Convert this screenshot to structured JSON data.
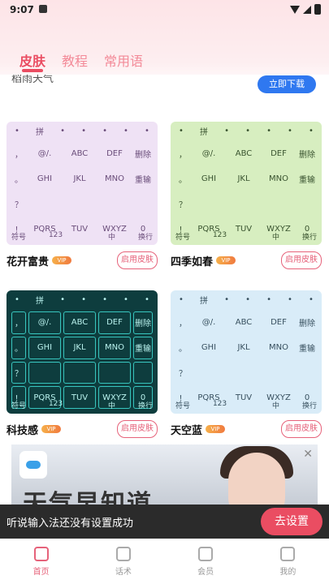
{
  "status_bar": {
    "time": "9:07"
  },
  "tabs": [
    {
      "label": "皮肤",
      "active": true
    },
    {
      "label": "教程",
      "active": false
    },
    {
      "label": "常用语",
      "active": false
    }
  ],
  "top_item": {
    "partial_name": "稻雨天气",
    "download_label": "立即下载"
  },
  "keyboard": {
    "pinyin_label": "拼",
    "rows": [
      [
        "，",
        "@/.",
        "ABC",
        "DEF",
        "删除"
      ],
      [
        "。",
        "GHI",
        "JKL",
        "MNO",
        "重输"
      ],
      [
        "？",
        "",
        "",
        "",
        ""
      ],
      [
        "！",
        "PQRS",
        "TUV",
        "WXYZ",
        "0"
      ]
    ],
    "bottom_row": [
      "符号",
      "123",
      "",
      "中",
      "换行"
    ]
  },
  "skins": [
    {
      "name": "花开富贵",
      "vip": "VIP",
      "button": "启用皮肤",
      "bg": "#efe2f5",
      "key_color": "#6a4d7a"
    },
    {
      "name": "四季如春",
      "vip": "VIP",
      "button": "启用皮肤",
      "bg": "#d7eec0",
      "key_color": "#39532f"
    },
    {
      "name": "科技感",
      "vip": "VIP",
      "button": "启用皮肤",
      "bg": "#0e3d3e",
      "key_color": "#b9f2ee"
    },
    {
      "name": "天空蓝",
      "vip": "VIP",
      "button": "启用皮肤",
      "bg": "#d9ecf8",
      "key_color": "#38505f"
    }
  ],
  "banner": {
    "headline": "天气早知道",
    "close": "✕"
  },
  "toast": {
    "message": "听说输入法还没有设置成功",
    "action": "去设置"
  },
  "nav": [
    {
      "label": "首页",
      "icon": "home-icon",
      "active": true
    },
    {
      "label": "话术",
      "icon": "chat-icon",
      "active": false
    },
    {
      "label": "会员",
      "icon": "crown-icon",
      "active": false
    },
    {
      "label": "我的",
      "icon": "profile-icon",
      "active": false
    }
  ],
  "colors": {
    "accent": "#ea4d62",
    "download": "#2f78f0"
  }
}
